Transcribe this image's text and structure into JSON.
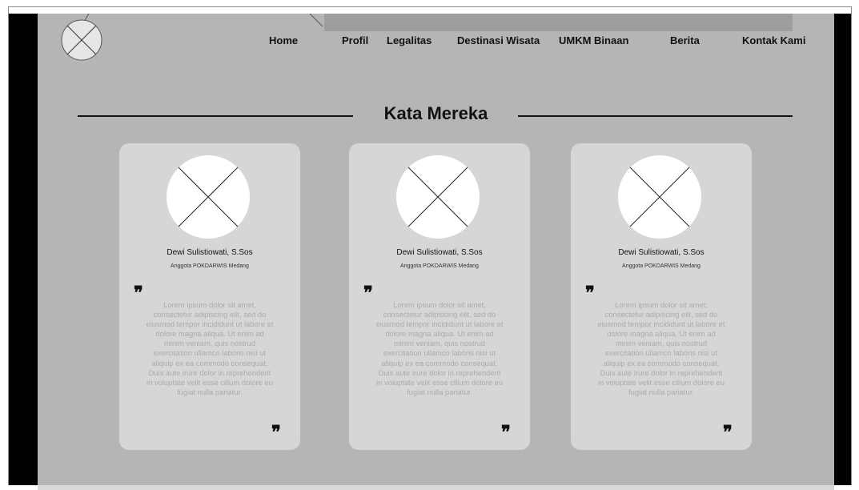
{
  "nav": {
    "items": [
      {
        "label": "Home"
      },
      {
        "label": "Profil"
      },
      {
        "label": "Legalitas"
      },
      {
        "label": "Destinasi Wisata"
      },
      {
        "label": "UMKM Binaan"
      },
      {
        "label": "Berita"
      },
      {
        "label": "Kontak Kami"
      }
    ]
  },
  "section": {
    "title": "Kata Mereka"
  },
  "testimonials": [
    {
      "name": "Dewi Sulistiowati, S.Sos",
      "role": "Anggota POKDARWIS Medang",
      "quote": "Lorem ipsum dolor sit amet, consectetur adipiscing elit, sed do eiusmod tempor incididunt ut labore et dolore magna aliqua. Ut enim ad minim veniam, quis nostrud exercitation ullamco laboris nisi ut aliquip ex ea commodo consequat. Duis aute irure dolor in reprehenderit in voluptate velit esse cillum dolore eu fugiat nulla pariatur."
    },
    {
      "name": "Dewi Sulistiowati, S.Sos",
      "role": "Anggota POKDARWIS Medang",
      "quote": "Lorem ipsum dolor sit amet, consectetur adipiscing elit, sed do eiusmod tempor incididunt ut labore et dolore magna aliqua. Ut enim ad minim veniam, quis nostrud exercitation ullamco laboris nisi ut aliquip ex ea commodo consequat. Duis aute irure dolor in reprehenderit in voluptate velit esse cillum dolore eu fugiat nulla pariatur."
    },
    {
      "name": "Dewi Sulistiowati, S.Sos",
      "role": "Anggota POKDARWIS Medang",
      "quote": "Lorem ipsum dolor sit amet, consectetur adipiscing elit, sed do eiusmod tempor incididunt ut labore et dolore magna aliqua. Ut enim ad minim veniam, quis nostrud exercitation ullamco laboris nisi ut aliquip ex ea commodo consequat. Duis aute irure dolor in reprehenderit in voluptate velit esse cillum dolore eu fugiat nulla pariatur."
    }
  ],
  "icons": {
    "logo": "logo-placeholder-icon",
    "avatar": "avatar-placeholder-icon",
    "quote": "quote-icon"
  },
  "colors": {
    "page_background": "#b5b5b5",
    "card_background": "#d6d6d6",
    "text": "#111111",
    "quote_text": "#ababab"
  }
}
